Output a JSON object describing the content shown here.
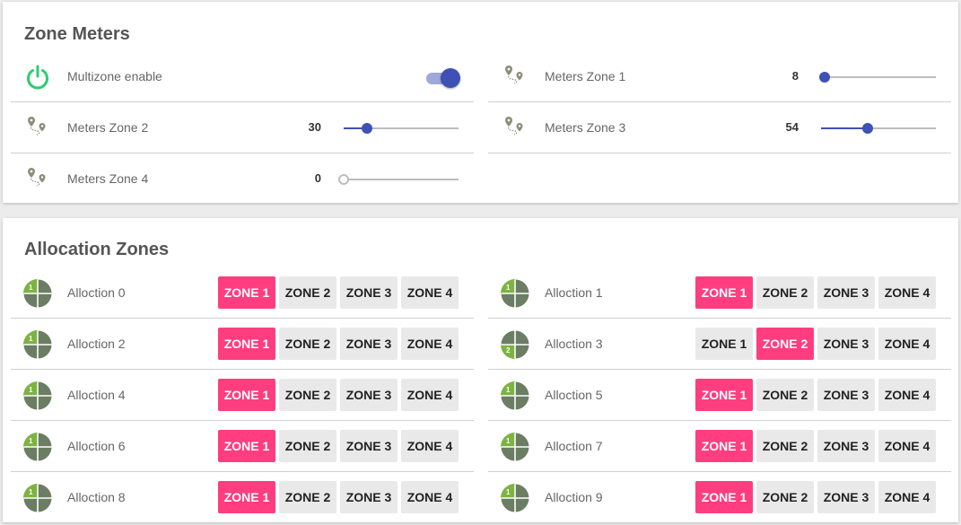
{
  "meters": {
    "title": "Zone Meters",
    "multizone": {
      "label": "Multizone enable",
      "enabled": true
    },
    "zones": [
      {
        "label": "Meters Zone 1",
        "value": "8",
        "level": 0.03
      },
      {
        "label": "Meters Zone 2",
        "value": "30",
        "level": 0.2
      },
      {
        "label": "Meters Zone 3",
        "value": "54",
        "level": 0.41
      },
      {
        "label": "Meters Zone 4",
        "value": "0",
        "level": 0.0
      }
    ]
  },
  "allocation": {
    "title": "Allocation Zones",
    "zone_labels": [
      "ZONE 1",
      "ZONE 2",
      "ZONE 3",
      "ZONE 4"
    ],
    "rows": [
      {
        "label": "Alloction 0",
        "selected": 0,
        "icon_number": "1"
      },
      {
        "label": "Alloction 1",
        "selected": 0,
        "icon_number": "1"
      },
      {
        "label": "Alloction 2",
        "selected": 0,
        "icon_number": "1"
      },
      {
        "label": "Alloction 3",
        "selected": 1,
        "icon_number": "2"
      },
      {
        "label": "Alloction 4",
        "selected": 0,
        "icon_number": "1"
      },
      {
        "label": "Alloction 5",
        "selected": 0,
        "icon_number": "1"
      },
      {
        "label": "Alloction 6",
        "selected": 0,
        "icon_number": "1"
      },
      {
        "label": "Alloction 7",
        "selected": 0,
        "icon_number": "1"
      },
      {
        "label": "Alloction 8",
        "selected": 0,
        "icon_number": "1"
      },
      {
        "label": "Alloction 9",
        "selected": 0,
        "icon_number": "1"
      }
    ]
  },
  "colors": {
    "accent": "#3f51b5",
    "zone_active": "#ff3d7f",
    "power_icon": "#2ecc71",
    "zone_icon_base": "#6b7d63",
    "zone_icon_highlight": "#7cb342"
  },
  "icons": {
    "power": "power-icon",
    "meter": "map-pins-icon",
    "zone": "zone-quadrant-icon"
  }
}
